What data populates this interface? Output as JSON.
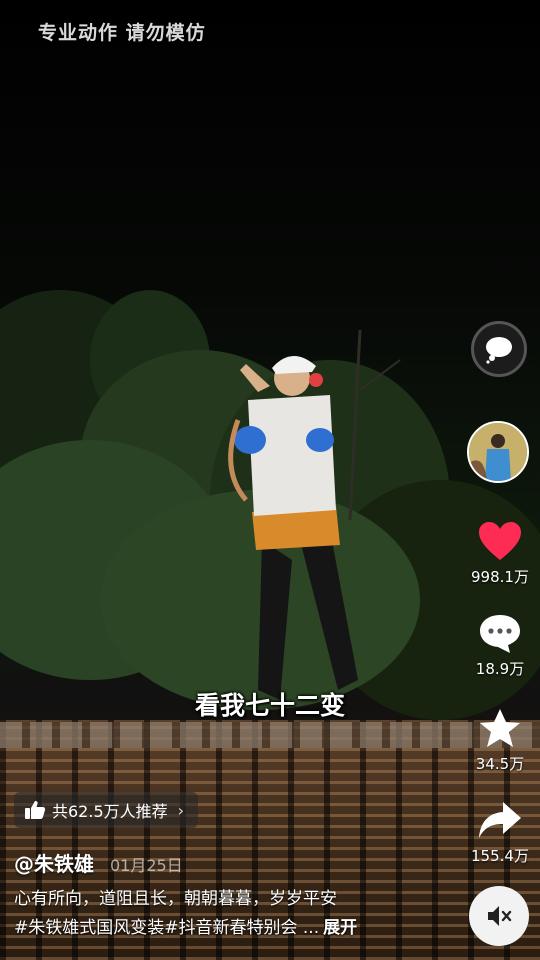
{
  "overlay": {
    "top_warning": "专业动作  请勿模仿",
    "subtitle": "看我七十二变"
  },
  "rail": {
    "likes": "998.1万",
    "comments": "18.9万",
    "favorites": "34.5万",
    "shares": "155.4万",
    "like_color": "#fe2c55"
  },
  "video": {
    "recommend_text": "共62.5万人推荐",
    "author": "@朱铁雄",
    "date": "01月25日",
    "description": "心有所向，道阻且长，朝朝暮暮，岁岁平安",
    "tags": "#朱铁雄式国风变装#抖音新春特别会 ...",
    "expand_label": "展开"
  },
  "icons": [
    "speech-bubble-icon",
    "avatar",
    "heart-icon",
    "comment-icon",
    "star-icon",
    "share-arrow-icon",
    "mute-icon",
    "thumbs-up-icon",
    "chevron-right-icon"
  ]
}
